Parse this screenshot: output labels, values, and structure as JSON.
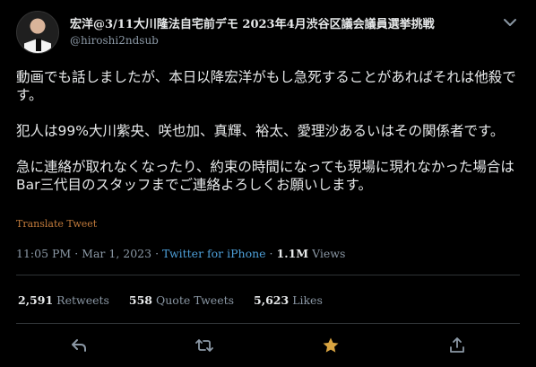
{
  "tweet": {
    "author": {
      "name": "宏洋@3/11大川隆法自宅前デモ 2023年4月渋谷区議会議員選挙挑戦",
      "handle": "@hiroshi2ndsub"
    },
    "paragraphs": [
      "動画でも話しましたが、本日以降宏洋がもし急死することがあればそれは他殺です。",
      "犯人は99%大川紫央、咲也加、真輝、裕太、愛理沙あるいはその関係者です。",
      "急に連絡が取れなくなったり、約束の時間になっても現場に現れなかった場合はBar三代目のスタッフまでご連絡よろしくお願いします。"
    ],
    "translate_label": "Translate Tweet",
    "time": "11:05 PM",
    "date": "Mar 1, 2023",
    "source": "Twitter for iPhone",
    "views_count": "1.1M",
    "views_label": "Views",
    "separator": "·",
    "stats": {
      "retweets_count": "2,591",
      "retweets_label": "Retweets",
      "quotes_count": "558",
      "quotes_label": "Quote Tweets",
      "likes_count": "5,623",
      "likes_label": "Likes"
    },
    "icons": {
      "more": "chevron-down-icon",
      "reply": "reply-icon",
      "retweet": "retweet-icon",
      "like": "star-icon",
      "share": "share-icon"
    },
    "colors": {
      "background": "#000000",
      "text": "#e7e9ea",
      "muted": "#8b98a5",
      "link": "#4ea0d9",
      "translate": "#c17a3b",
      "like_active": "#d9a441",
      "divider": "#2f3336"
    }
  }
}
